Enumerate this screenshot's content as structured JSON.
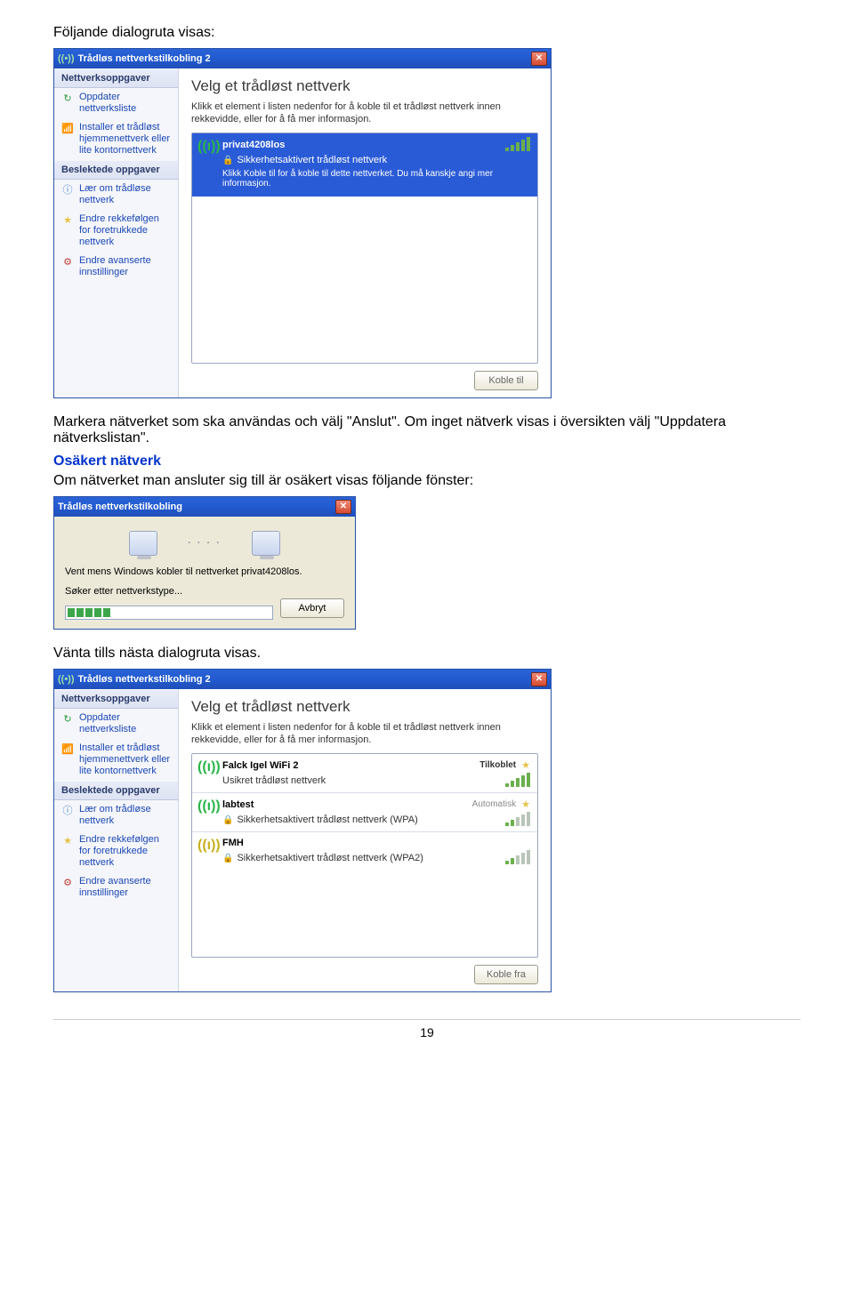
{
  "doc": {
    "line1": "Följande dialogruta visas:",
    "line2": "Markera nätverket som ska användas och välj \"Anslut\". Om inget nätverk visas i översikten välj \"Uppdatera nätverkslistan\".",
    "heading2": "Osäkert nätverk",
    "line3": "Om nätverket man ansluter sig till är osäkert visas följande fönster:",
    "line4": "Vänta tills nästa dialogruta visas.",
    "pagenum": "19"
  },
  "dialog1": {
    "title": "Trådløs nettverkstilkobling 2",
    "sidebar": {
      "head1": "Nettverksoppgaver",
      "items1": [
        "Oppdater nettverksliste",
        "Installer et trådløst hjemmenettverk eller lite kontornettverk"
      ],
      "head2": "Beslektede oppgaver",
      "items2": [
        "Lær om trådløse nettverk",
        "Endre rekkefølgen for foretrukkede nettverk",
        "Endre avanserte innstillinger"
      ]
    },
    "main": {
      "title": "Velg et trådløst nettverk",
      "sub": "Klikk et element i listen nedenfor for å koble til et trådløst nettverk innen rekkevidde, eller for å få mer informasjon.",
      "net_ssid": "privat4208los",
      "net_sec": "Sikkerhetsaktivert trådløst nettverk",
      "net_hint": "Klikk Koble til for å koble til dette nettverket. Du må kanskje angi mer informasjon.",
      "btn": "Koble til"
    }
  },
  "dialog2": {
    "title": "Trådløs nettverkstilkobling",
    "line1": "Vent mens Windows kobler til nettverket privat4208los.",
    "line2": "Søker etter nettverkstype...",
    "btn": "Avbryt"
  },
  "dialog3": {
    "title": "Trådløs nettverkstilkobling 2",
    "sidebar": {
      "head1": "Nettverksoppgaver",
      "items1": [
        "Oppdater nettverksliste",
        "Installer et trådløst hjemmenettverk eller lite kontornettverk"
      ],
      "head2": "Beslektede oppgaver",
      "items2": [
        "Lær om trådløse nettverk",
        "Endre rekkefølgen for foretrukkede nettverk",
        "Endre avanserte innstillinger"
      ]
    },
    "main": {
      "title": "Velg et trådløst nettverk",
      "sub": "Klikk et element i listen nedenfor for å koble til et trådløst nettverk innen rekkevidde, eller for å få mer informasjon.",
      "nets": [
        {
          "ssid": "Falck Igel WiFi 2",
          "status": "Tilkoblet",
          "sec": "Usikret trådløst nettverk"
        },
        {
          "ssid": "labtest",
          "status": "Automatisk",
          "sec": "Sikkerhetsaktivert trådløst nettverk (WPA)"
        },
        {
          "ssid": "FMH",
          "status": "",
          "sec": "Sikkerhetsaktivert trådløst nettverk (WPA2)"
        }
      ],
      "btn": "Koble fra"
    }
  }
}
